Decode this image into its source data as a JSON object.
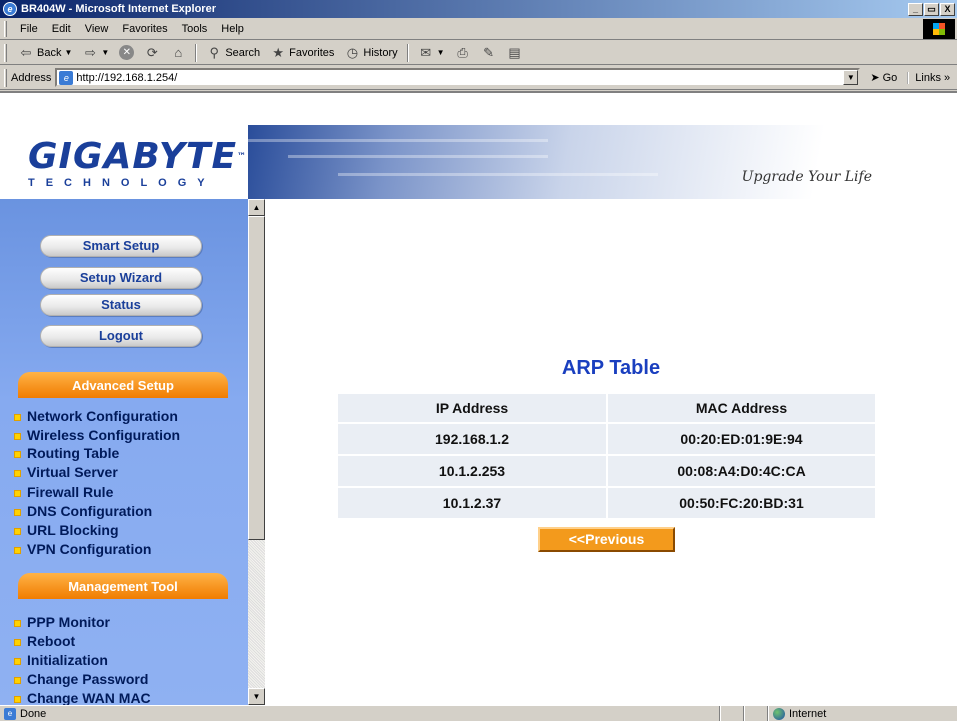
{
  "window": {
    "title": "BR404W - Microsoft Internet Explorer",
    "controls": [
      "_",
      "·",
      "X"
    ]
  },
  "menubar": {
    "items": [
      "File",
      "Edit",
      "View",
      "Favorites",
      "Tools",
      "Help"
    ]
  },
  "toolbar": {
    "back_label": "Back",
    "search_label": "Search",
    "favorites_label": "Favorites",
    "history_label": "History"
  },
  "addressbar": {
    "label": "Address",
    "url": "http://192.168.1.254/",
    "go_label": "Go",
    "links_label": "Links"
  },
  "banner": {
    "brand": "GIGABYTE",
    "trademark": "™",
    "subbrand": "TECHNOLOGY",
    "slogan": "Upgrade Your Life"
  },
  "sidebar": {
    "buttons": [
      "Smart Setup",
      "Setup Wizard",
      "Status",
      "Logout"
    ],
    "sections": {
      "advanced": {
        "title": "Advanced Setup",
        "items": [
          "Network Configuration",
          "Wireless Configuration",
          "Routing Table",
          "Virtual Server",
          "Firewall Rule",
          "DNS Configuration",
          "URL Blocking",
          "VPN Configuration"
        ]
      },
      "management": {
        "title": "Management Tool",
        "items": [
          "PPP Monitor",
          "Reboot",
          "Initialization",
          "Change Password",
          "Change WAN MAC"
        ]
      }
    }
  },
  "content": {
    "title": "ARP Table",
    "columns": [
      "IP Address",
      "MAC Address"
    ],
    "rows": [
      [
        "192.168.1.2",
        "00:20:ED:01:9E:94"
      ],
      [
        "10.1.2.253",
        "00:08:A4:D0:4C:CA"
      ],
      [
        "10.1.2.37",
        "00:50:FC:20:BD:31"
      ]
    ],
    "previous_label": "<<Previous"
  },
  "statusbar": {
    "status": "Done",
    "zone": "Internet"
  }
}
